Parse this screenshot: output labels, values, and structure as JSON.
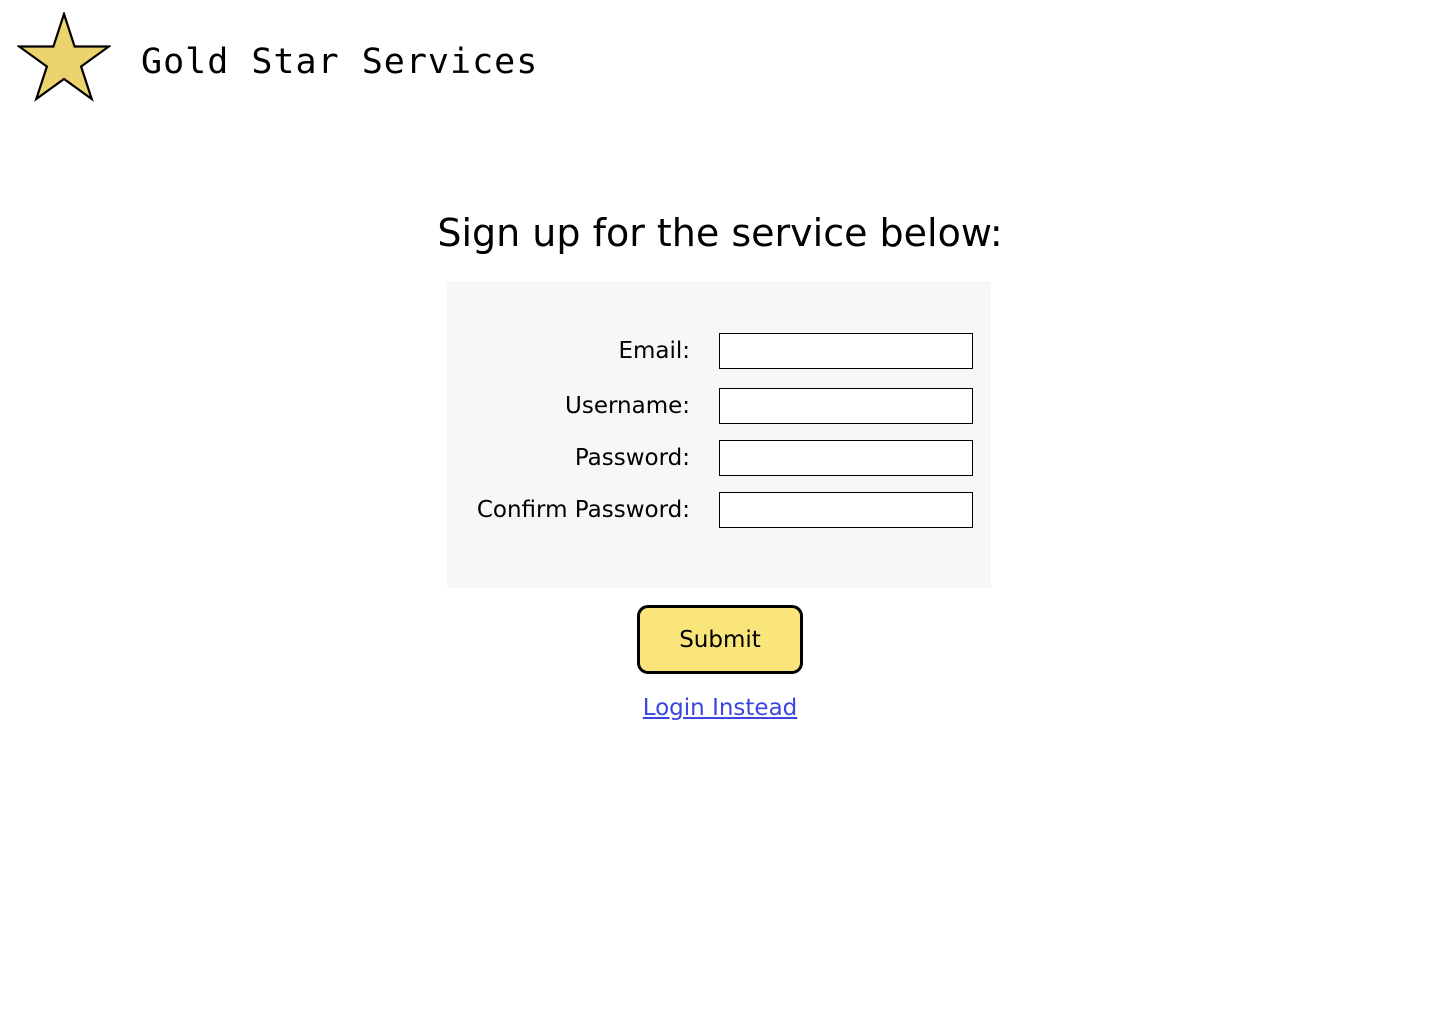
{
  "header": {
    "logo_icon": "star-icon",
    "brand_name": "Gold Star Services"
  },
  "main": {
    "title": "Sign up for the service below:"
  },
  "form": {
    "fields": [
      {
        "label": "Email:",
        "value": "",
        "type": "email"
      },
      {
        "label": "Username:",
        "value": "",
        "type": "text"
      },
      {
        "label": "Password:",
        "value": "",
        "type": "password"
      },
      {
        "label": "Confirm Password:",
        "value": "",
        "type": "password"
      }
    ],
    "submit_label": "Submit",
    "alt_link_label": "Login Instead"
  },
  "colors": {
    "star_fill": "#ecd36e",
    "button_fill": "#f9e57a",
    "panel_bg": "#f7f7f7",
    "link": "#3b45e0"
  }
}
